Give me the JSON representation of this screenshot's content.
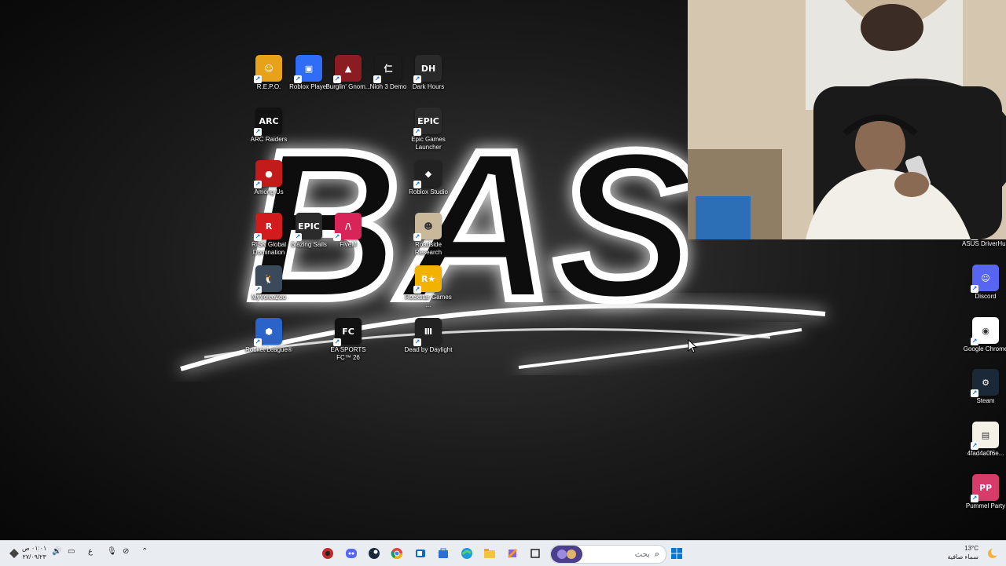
{
  "desktop_icons": [
    {
      "id": "repo",
      "label": "R.E.P.O.",
      "bg": "#e7a21a",
      "glyph": "☺"
    },
    {
      "id": "roblox",
      "label": "Roblox Player",
      "bg": "#2f6df6",
      "glyph": "▣"
    },
    {
      "id": "burglin",
      "label": "Burglin' Gnom...",
      "bg": "#8b1d22",
      "glyph": "▲"
    },
    {
      "id": "nioh",
      "label": "Nioh 3 Demo",
      "bg": "#1b1b1b",
      "glyph": "仁"
    },
    {
      "id": "darkhours",
      "label": "Dark Hours",
      "bg": "#2a2a2a",
      "glyph": "DH"
    },
    {
      "id": "arc",
      "label": "ARC Raiders",
      "bg": "#111",
      "glyph": "ARC"
    },
    {
      "id": "epic",
      "label": "Epic Games Launcher",
      "bg": "#2b2b2b",
      "glyph": "EPIC"
    },
    {
      "id": "amongus",
      "label": "Among Us",
      "bg": "#c21b1b",
      "glyph": "●"
    },
    {
      "id": "robloxstudio",
      "label": "Roblox Studio",
      "bg": "#222",
      "glyph": "◆"
    },
    {
      "id": "risk",
      "label": "RISK Global Domination",
      "bg": "#d01c1c",
      "glyph": "R"
    },
    {
      "id": "blazing",
      "label": "Blazing Sails",
      "bg": "#2b2b2b",
      "glyph": "EPIC"
    },
    {
      "id": "fivem",
      "label": "FiveM",
      "bg": "#d9245a",
      "glyph": "/\\"
    },
    {
      "id": "roadside",
      "label": "Roadside Research",
      "bg": "#c9b89a",
      "glyph": "☻"
    },
    {
      "id": "myvoicezoo",
      "label": "MyVoiceZoo",
      "bg": "#3a4a5a",
      "glyph": "🐧"
    },
    {
      "id": "rockstar",
      "label": "Rockstar Games ...",
      "bg": "#f2b200",
      "glyph": "R★"
    },
    {
      "id": "rocketleague",
      "label": "Rocket League®",
      "bg": "#2b64c9",
      "glyph": "⬢"
    },
    {
      "id": "eafc",
      "label": "EA SPORTS FC™ 26",
      "bg": "#111",
      "glyph": "FC"
    },
    {
      "id": "dbd",
      "label": "Dead by Daylight",
      "bg": "#222",
      "glyph": "Ⅲ"
    },
    {
      "id": "asus",
      "label": "ASUS DriverHub",
      "bg": "#0d1b33",
      "glyph": "A"
    },
    {
      "id": "discord",
      "label": "Discord",
      "bg": "#5865f2",
      "glyph": "☺"
    },
    {
      "id": "chrome",
      "label": "Google Chrome",
      "bg": "#ffffff",
      "glyph": "◉"
    },
    {
      "id": "steam",
      "label": "Steam",
      "bg": "#1b2838",
      "glyph": "⚙"
    },
    {
      "id": "file",
      "label": "4fad4a0f6e...",
      "bg": "#f4f1e6",
      "glyph": "▤"
    },
    {
      "id": "pummel",
      "label": "Pummel Party",
      "bg": "#d63b6a",
      "glyph": "PP"
    }
  ],
  "wallpaper": {
    "text": "BAS"
  },
  "taskbar": {
    "search_placeholder": "بحث",
    "clock_time": "٠١:٠١ ص",
    "clock_date": "٢٧/٠٩/٢٣",
    "lang": "ع",
    "weather_temp": "13°C",
    "weather_desc": "سماء صافية"
  },
  "colors": {
    "taskbar_bg": "#e9edf2",
    "accent": "#0078d4"
  }
}
